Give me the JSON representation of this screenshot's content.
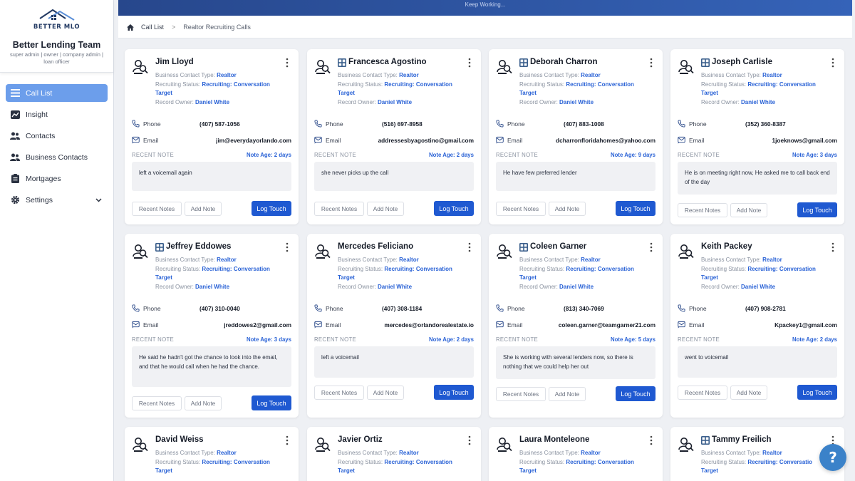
{
  "brand": {
    "logo_text": "BETTER MLO",
    "team_name": "Better Lending Team",
    "roles": "super admin | owner | company admin | loan officer"
  },
  "nav": [
    {
      "label": "Call List",
      "icon": "list-icon",
      "active": true
    },
    {
      "label": "Insight",
      "icon": "chart-icon"
    },
    {
      "label": "Contacts",
      "icon": "users-icon"
    },
    {
      "label": "Business Contacts",
      "icon": "users-icon"
    },
    {
      "label": "Mortgages",
      "icon": "clipboard-icon"
    },
    {
      "label": "Settings",
      "icon": "gear-icon",
      "has_chevron": true
    }
  ],
  "topbar": {
    "text": "Keep Working..."
  },
  "breadcrumb": {
    "home_icon": "home-icon",
    "items": [
      "Call List",
      "Realtor Recruiting Calls"
    ]
  },
  "labels": {
    "contact_type": "Business Contact Type:",
    "recruiting_status": "Recruiting Status:",
    "record_owner": "Record Owner:",
    "phone": "Phone",
    "email": "Email",
    "recent_note": "RECENT NOTE",
    "recent_notes_btn": "Recent Notes",
    "add_note_btn": "Add Note",
    "log_touch_btn": "Log Touch"
  },
  "cards": [
    {
      "name": "Jim Lloyd",
      "badge": false,
      "contact_type": "Realtor",
      "status_1": "Recruiting: Conversation",
      "status_2": "Target",
      "owner": "Daniel White",
      "phone": "(407) 587-1056",
      "email": "jim@everydayorlando.com",
      "note_age": "Note Age: 2 days",
      "note": "left a voicemail again"
    },
    {
      "name": "Francesca Agostino",
      "badge": true,
      "contact_type": "Realtor",
      "status_1": "Recruiting: Conversation",
      "status_2": "Target",
      "owner": "Daniel White",
      "phone": "(516) 697-8958",
      "email": "addressesbyagostino@gmail.com",
      "note_age": "Note Age: 2 days",
      "note": "she never picks up the call"
    },
    {
      "name": "Deborah Charron",
      "badge": true,
      "contact_type": "Realtor",
      "status_1": "Recruiting: Conversation",
      "status_2": "Target",
      "owner": "Daniel White",
      "phone": "(407) 883-1008",
      "email": "dcharronfloridahomes@yahoo.com",
      "note_age": "Note Age: 9 days",
      "note": "He have few preferred lender"
    },
    {
      "name": "Joseph Carlisle",
      "badge": true,
      "contact_type": "Realtor",
      "status_1": "Recruiting: Conversation",
      "status_2": "Target",
      "owner": "Daniel White",
      "phone": "(352) 360-8387",
      "email": "1joeknows@gmail.com",
      "note_age": "Note Age: 3 days",
      "note": "He is on meeting right now, He asked me to call back end of the day"
    },
    {
      "name": "Jeffrey Eddowes",
      "badge": true,
      "contact_type": "Realtor",
      "status_1": "Recruiting: Conversation",
      "status_2": "Target",
      "owner": "Daniel White",
      "phone": "(407) 310-0040",
      "email": "jreddowes2@gmail.com",
      "note_age": "Note Age: 3 days",
      "note": "He said he hadn't got the chance to look into the email, and that he would call when he had the chance."
    },
    {
      "name": "Mercedes Feliciano",
      "badge": false,
      "contact_type": "Realtor",
      "status_1": "Recruiting: Conversation",
      "status_2": "Target",
      "owner": "Daniel White",
      "phone": "(407) 308-1184",
      "email": "mercedes@orlandorealestate.io",
      "note_age": "Note Age: 2 days",
      "note": "left a voicemail"
    },
    {
      "name": "Coleen Garner",
      "badge": true,
      "contact_type": "Realtor",
      "status_1": "Recruiting: Conversation",
      "status_2": "Target",
      "owner": "Daniel White",
      "phone": "(813) 340-7069",
      "email": "coleen.garner@teamgarner21.com",
      "note_age": "Note Age: 5 days",
      "note": "She is working with several lenders now, so there is nothing that we could help her out"
    },
    {
      "name": "Keith Packey",
      "badge": false,
      "contact_type": "Realtor",
      "status_1": "Recruiting: Conversation",
      "status_2": "Target",
      "owner": "Daniel White",
      "phone": "(407) 908-2781",
      "email": "Kpackey1@gmail.com",
      "note_age": "Note Age: 2 days",
      "note": "went to voicemail"
    },
    {
      "name": "David Weiss",
      "badge": false,
      "contact_type": "Realtor",
      "status_1": "Recruiting: Conversation",
      "status_2": "Target"
    },
    {
      "name": "Javier Ortiz",
      "badge": false,
      "contact_type": "Realtor",
      "status_1": "Recruiting: Conversation",
      "status_2": "Target"
    },
    {
      "name": "Laura Monteleone",
      "badge": false,
      "contact_type": "Realtor",
      "status_1": "Recruiting: Conversation",
      "status_2": "Target"
    },
    {
      "name": "Tammy Freilich",
      "badge": true,
      "contact_type": "Realtor",
      "status_1": "Recruiting: Conversatio",
      "status_2": "Target"
    }
  ],
  "help": {
    "label": "?"
  }
}
